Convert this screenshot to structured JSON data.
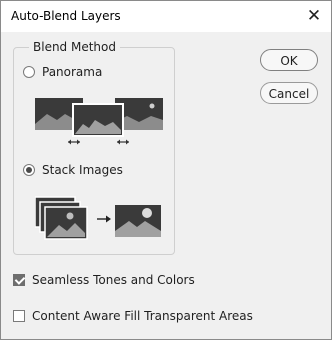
{
  "window": {
    "title": "Auto-Blend Layers",
    "close_glyph": "✕"
  },
  "blend_method": {
    "label": "Blend Method",
    "options": [
      {
        "label": "Panorama",
        "selected": false,
        "icon": "panorama-illustration"
      },
      {
        "label": "Stack Images",
        "selected": true,
        "icon": "stack-images-illustration"
      }
    ]
  },
  "buttons": {
    "ok": "OK",
    "cancel": "Cancel"
  },
  "options": [
    {
      "label": "Seamless Tones and Colors",
      "checked": true
    },
    {
      "label": "Content Aware Fill Transparent Areas",
      "checked": false
    }
  ]
}
